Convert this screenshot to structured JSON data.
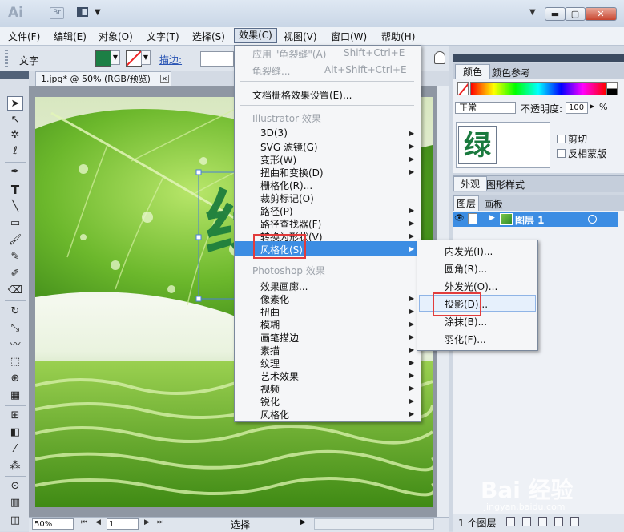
{
  "app": {
    "logo_text": "Ai",
    "bridge_text": "Br"
  },
  "window": {
    "minimize": "▬",
    "maximize": "▢",
    "close": "✕"
  },
  "menubar": [
    "文件(F)",
    "编辑(E)",
    "对象(O)",
    "文字(T)",
    "选择(S)",
    "效果(C)",
    "视图(V)",
    "窗口(W)",
    "帮助(H)"
  ],
  "controlbar": {
    "label": "文字",
    "stroke_label": "描边:",
    "fill_color": "#1c7f45"
  },
  "document": {
    "tab_title": "1.jpg* @ 50% (RGB/预览)",
    "canvas_letter": "绿"
  },
  "effect_menu": {
    "apply_last": "应用 \"龟裂缝\"(A)",
    "apply_last_shortcut": "Shift+Ctrl+E",
    "last_effect": "龟裂缝...",
    "last_effect_shortcut": "Alt+Shift+Ctrl+E",
    "raster_settings": "文档栅格效果设置(E)...",
    "illustrator_header": "Illustrator 效果",
    "illustrator_items": [
      "3D(3)",
      "SVG 滤镜(G)",
      "变形(W)",
      "扭曲和变换(D)",
      "栅格化(R)...",
      "裁剪标记(O)",
      "路径(P)",
      "路径查找器(F)",
      "转换为形状(V)",
      "风格化(S)"
    ],
    "photoshop_header": "Photoshop 效果",
    "photoshop_items": [
      "效果画廊...",
      "像素化",
      "扭曲",
      "模糊",
      "画笔描边",
      "素描",
      "纹理",
      "艺术效果",
      "视频",
      "锐化",
      "风格化"
    ]
  },
  "stylize_submenu": [
    "内发光(I)...",
    "圆角(R)...",
    "外发光(O)...",
    "投影(D)...",
    "涂抹(B)...",
    "羽化(F)..."
  ],
  "panels": {
    "color_tab": "颜色",
    "color_ref_tab": "颜色参考",
    "blend_mode": "正常",
    "opacity_label": "不透明度:",
    "opacity_value": "100",
    "opacity_unit": "%",
    "clip_label": "剪切",
    "invert_mask_label": "反相蒙版",
    "thumb_letter": "绿",
    "appearance_tab": "外观",
    "graphic_styles_tab": "图形样式",
    "layers_tab": "图层",
    "artboards_tab": "画板",
    "layer_name": "图层 1",
    "layer_count": "1 个图层"
  },
  "statusbar": {
    "zoom": "50%",
    "page": "1",
    "status": "选择"
  },
  "watermark": {
    "main": "Bai 经验",
    "sub": "jingyan.baidu.com"
  }
}
